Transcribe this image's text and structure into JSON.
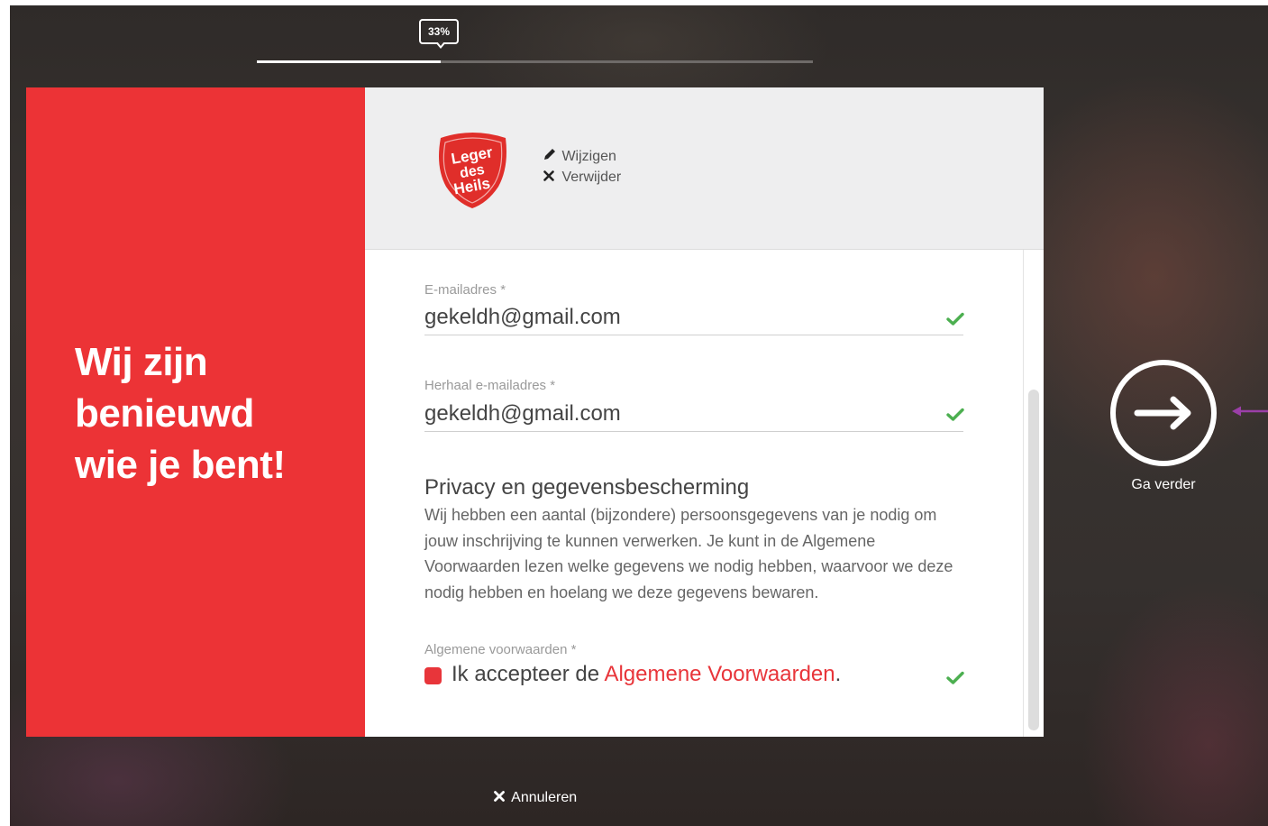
{
  "progress": {
    "percent_label": "33%",
    "fraction": 0.33
  },
  "headline": {
    "lines": [
      "Wij zijn",
      "benieuwd",
      "wie je bent!"
    ]
  },
  "logo": {
    "text_lines": [
      "Leger",
      "des",
      "Heils"
    ]
  },
  "logo_actions": {
    "edit": "Wijzigen",
    "remove": "Verwijder"
  },
  "form": {
    "email": {
      "label": "E-mailadres *",
      "value": "gekeldh@gmail.com"
    },
    "email_repeat": {
      "label": "Herhaal e-mailadres *",
      "value": "gekeldh@gmail.com"
    },
    "privacy": {
      "title": "Privacy en gegevensbescherming",
      "text": "Wij hebben een aantal (bijzondere) persoonsgegevens van je nodig om jouw inschrijving te kunnen verwerken. Je kunt in de Algemene Voorwaarden lezen welke gegevens we nodig hebben, waarvoor we deze nodig hebben en hoelang we deze gegevens bewaren."
    },
    "terms": {
      "label": "Algemene voorwaarden *",
      "prefix": "Ik accepteer de ",
      "link": "Algemene Voorwaarden",
      "suffix": "."
    }
  },
  "next": {
    "label": "Ga verder"
  },
  "cancel": {
    "label": "Annuleren"
  },
  "icons": {
    "edit": "pencil-icon",
    "remove": "close-icon",
    "valid": "check-icon",
    "next": "arrow-right-icon",
    "cancel": "close-icon"
  },
  "colors": {
    "brand_red": "#ec3336",
    "valid_green": "#4caf50",
    "link_red": "#e8353a",
    "annotation_purple": "#9b3fa8"
  }
}
